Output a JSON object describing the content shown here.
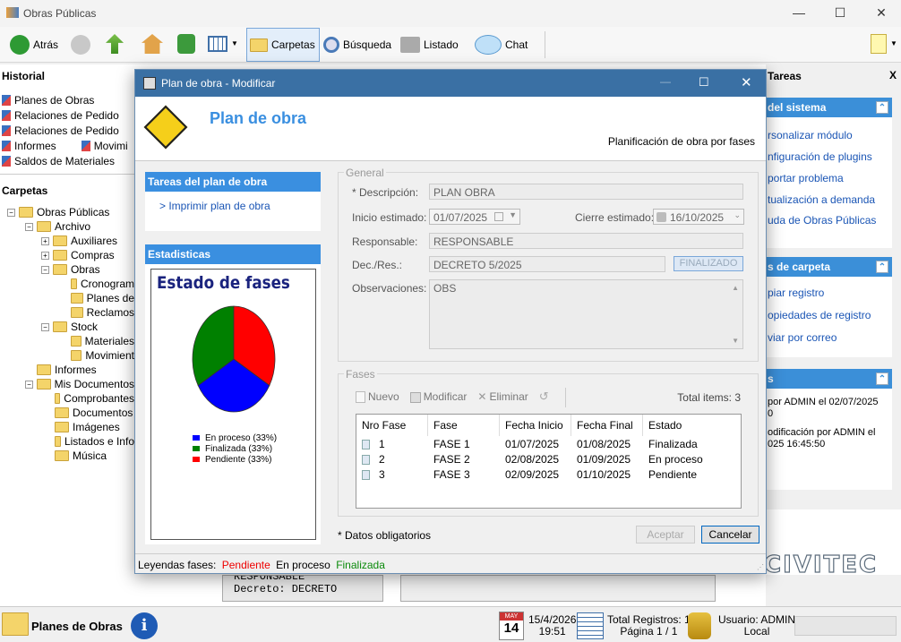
{
  "app": {
    "title": "Obras Públicas"
  },
  "toolbar": {
    "back": "Atrás",
    "folders": "Carpetas",
    "search": "Búsqueda",
    "list": "Listado",
    "chat": "Chat"
  },
  "left": {
    "history_title": "Historial",
    "history": [
      "Planes de Obras",
      "Relaciones de Pedido",
      "Relaciones de Pedido",
      "Informes",
      "Movimi",
      "Saldos de Materiales"
    ],
    "folders_title": "Carpetas",
    "tree": {
      "root": "Obras Públicas",
      "archivo": "Archivo",
      "auxiliares": "Auxiliares",
      "compras": "Compras",
      "obras": "Obras",
      "cronograma": "Cronogram",
      "planes": "Planes de",
      "reclamos": "Reclamos",
      "stock": "Stock",
      "materiales": "Materiales",
      "movimientos": "Movimient",
      "informes": "Informes",
      "mis_docs": "Mis Documentos",
      "comprobantes": "Comprobantes",
      "documentos": "Documentos",
      "imagenes": "Imágenes",
      "listados": "Listados e Info",
      "musica": "Música"
    }
  },
  "right": {
    "title": "Tareas",
    "close": "X",
    "system_title": "del sistema",
    "system_links": [
      "rsonalizar módulo",
      "nfiguración de plugins",
      "portar problema",
      "tualización a demanda",
      "uda de Obras Públicas"
    ],
    "folder_title": "s de carpeta",
    "folder_links": [
      "piar registro",
      "opiedades de registro",
      "viar por correo"
    ],
    "info_title": "s",
    "info_lines": [
      "por ADMIN el 02/07/2025",
      "0",
      "odificación por ADMIN el",
      "025 16:45:50"
    ],
    "brand": "CIVITEC"
  },
  "dialog": {
    "title": "Plan de obra - Modificar",
    "heading": "Plan de obra",
    "subheading": "Planificación de obra por fases",
    "tasks_title": "Tareas del plan de obra",
    "print_link": "> Imprimir plan de obra",
    "stats_title": "Estadisticas",
    "general": "General",
    "desc_label": "* Descripción:",
    "desc_value": "PLAN OBRA",
    "start_label": "Inicio estimado:",
    "start_value": "01/07/2025",
    "end_label": "Cierre estimado:",
    "end_value": "16/10/2025",
    "resp_label": "Responsable:",
    "resp_value": "RESPONSABLE",
    "dec_label": "Dec./Res.:",
    "dec_value": "DECRETO 5/2025",
    "status_badge": "FINALIZADO",
    "obs_label": "Observaciones:",
    "obs_value": "OBS",
    "phases": "Fases",
    "new": "Nuevo",
    "edit": "Modificar",
    "delete": "Eliminar",
    "total": "Total items: 3",
    "columns": [
      "Nro Fase",
      "Fase",
      "Fecha Inicio",
      "Fecha Final",
      "Estado"
    ],
    "rows": [
      [
        "1",
        "FASE 1",
        "01/07/2025",
        "01/08/2025",
        "Finalizada"
      ],
      [
        "2",
        "FASE 2",
        "02/08/2025",
        "01/09/2025",
        "En proceso"
      ],
      [
        "3",
        "FASE 3",
        "02/09/2025",
        "01/10/2025",
        "Pendiente"
      ]
    ],
    "required": "* Datos obligatorios",
    "accept": "Aceptar",
    "cancel": "Cancelar",
    "legend_label": "Leyendas fases:",
    "legend_pending": "Pendiente",
    "legend_progress": "En proceso",
    "legend_done": "Finalizada"
  },
  "chart_data": {
    "type": "pie",
    "title": "Estado de fases",
    "categories": [
      "En proceso (33%)",
      "Finalizada (33%)",
      "Pendiente (33%)"
    ],
    "values": [
      33.3,
      33.3,
      33.3
    ],
    "colors": [
      "#0000ff",
      "#008000",
      "#ff0000"
    ]
  },
  "background": {
    "line1": "RESPONSABLE",
    "line2": "Decreto: DECRETO"
  },
  "status": {
    "module": "Planes de Obras",
    "date": "15/4/2026",
    "time": "19:51",
    "cal_month": "MAY",
    "cal_day": "14",
    "records": "Total Registros: 1",
    "page": "Página 1 / 1",
    "user": "Usuario: ADMIN",
    "location": "Local"
  }
}
